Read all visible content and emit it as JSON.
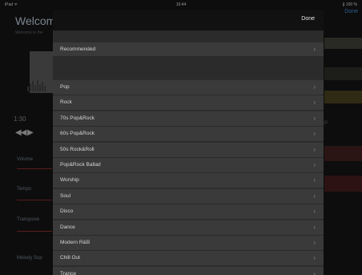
{
  "status_bar": {
    "left": "iPad ᯤ",
    "time": "10:44",
    "right": "∦ 100 %"
  },
  "background": {
    "title": "Welcom",
    "subtitle": "Welcome to the",
    "time_readout": "1:30",
    "transport": "◀◀ ▶",
    "labels": [
      "Volume",
      "Tempo",
      "Transpose",
      "Melody Sup"
    ],
    "right_done": "Done",
    "right_fragment": "P"
  },
  "modal": {
    "done_label": "Done",
    "recommended_label": "Recommended",
    "genres": [
      "Pop",
      "Rock",
      "70s Pop&Rock",
      "60s Pop&Rock",
      "50s Rock&Roll",
      "Pop&Rock Ballad",
      "Worship",
      "Soul",
      "Disco",
      "Dance",
      "Modern R&B",
      "Chill Out",
      "Trance"
    ]
  },
  "colors": {
    "done_accent": "#2d5f8f",
    "bg_line_accent": "#5a1c1c"
  },
  "icons": {
    "row_chevron": "chevron-right-icon"
  }
}
